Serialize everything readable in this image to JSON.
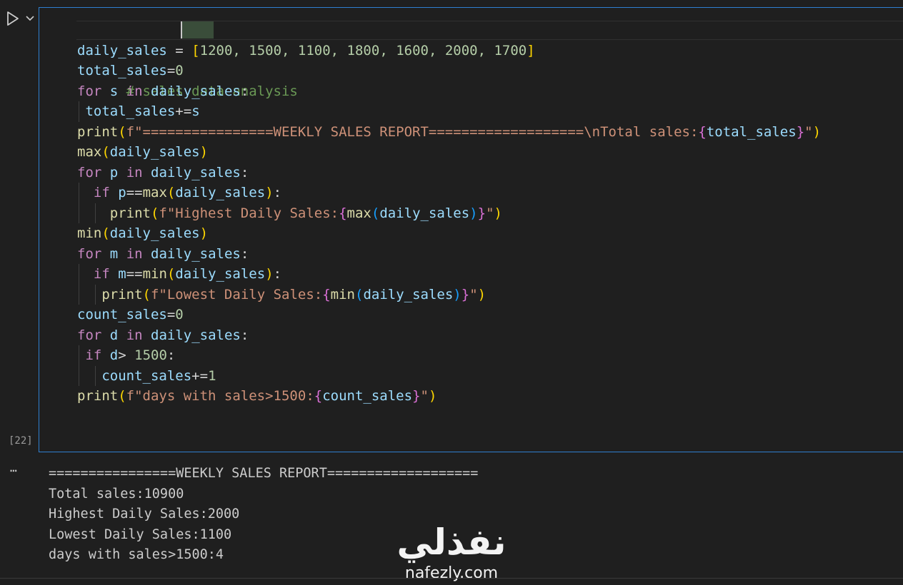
{
  "editor": {
    "run_icon": "play-icon",
    "run_menu_icon": "chevron-down-icon",
    "comment": "# sales data analysis",
    "values_list": "1200, 1500, 1100, 1800, 1600, 2000, 1700",
    "header_string": "f\"================WEEKLY SALES REPORT===================\\nTotal sales:",
    "highest_string": "f\"Highest Daily Sales:",
    "lowest_string": "f\"Lowest Daily Sales:",
    "days_string": "f\"days with sales>1500:",
    "execution_count": "[22]"
  },
  "output": {
    "menu_icon": "ellipsis-icon",
    "lines": [
      "================WEEKLY SALES REPORT===================",
      "Total sales:10900",
      "Highest Daily Sales:2000",
      "Lowest Daily Sales:1100",
      "days with sales>1500:4"
    ]
  },
  "watermark": {
    "arabic": "نفذلي",
    "latin": "nafezly.com"
  },
  "colors": {
    "background": "#1f1f1f",
    "cell_border": "#2f7fd0",
    "keyword": "#c586c0",
    "variable": "#9cdcfe",
    "function": "#dcdcaa",
    "number": "#b5cea8",
    "string": "#ce9178",
    "comment": "#6a9955"
  }
}
